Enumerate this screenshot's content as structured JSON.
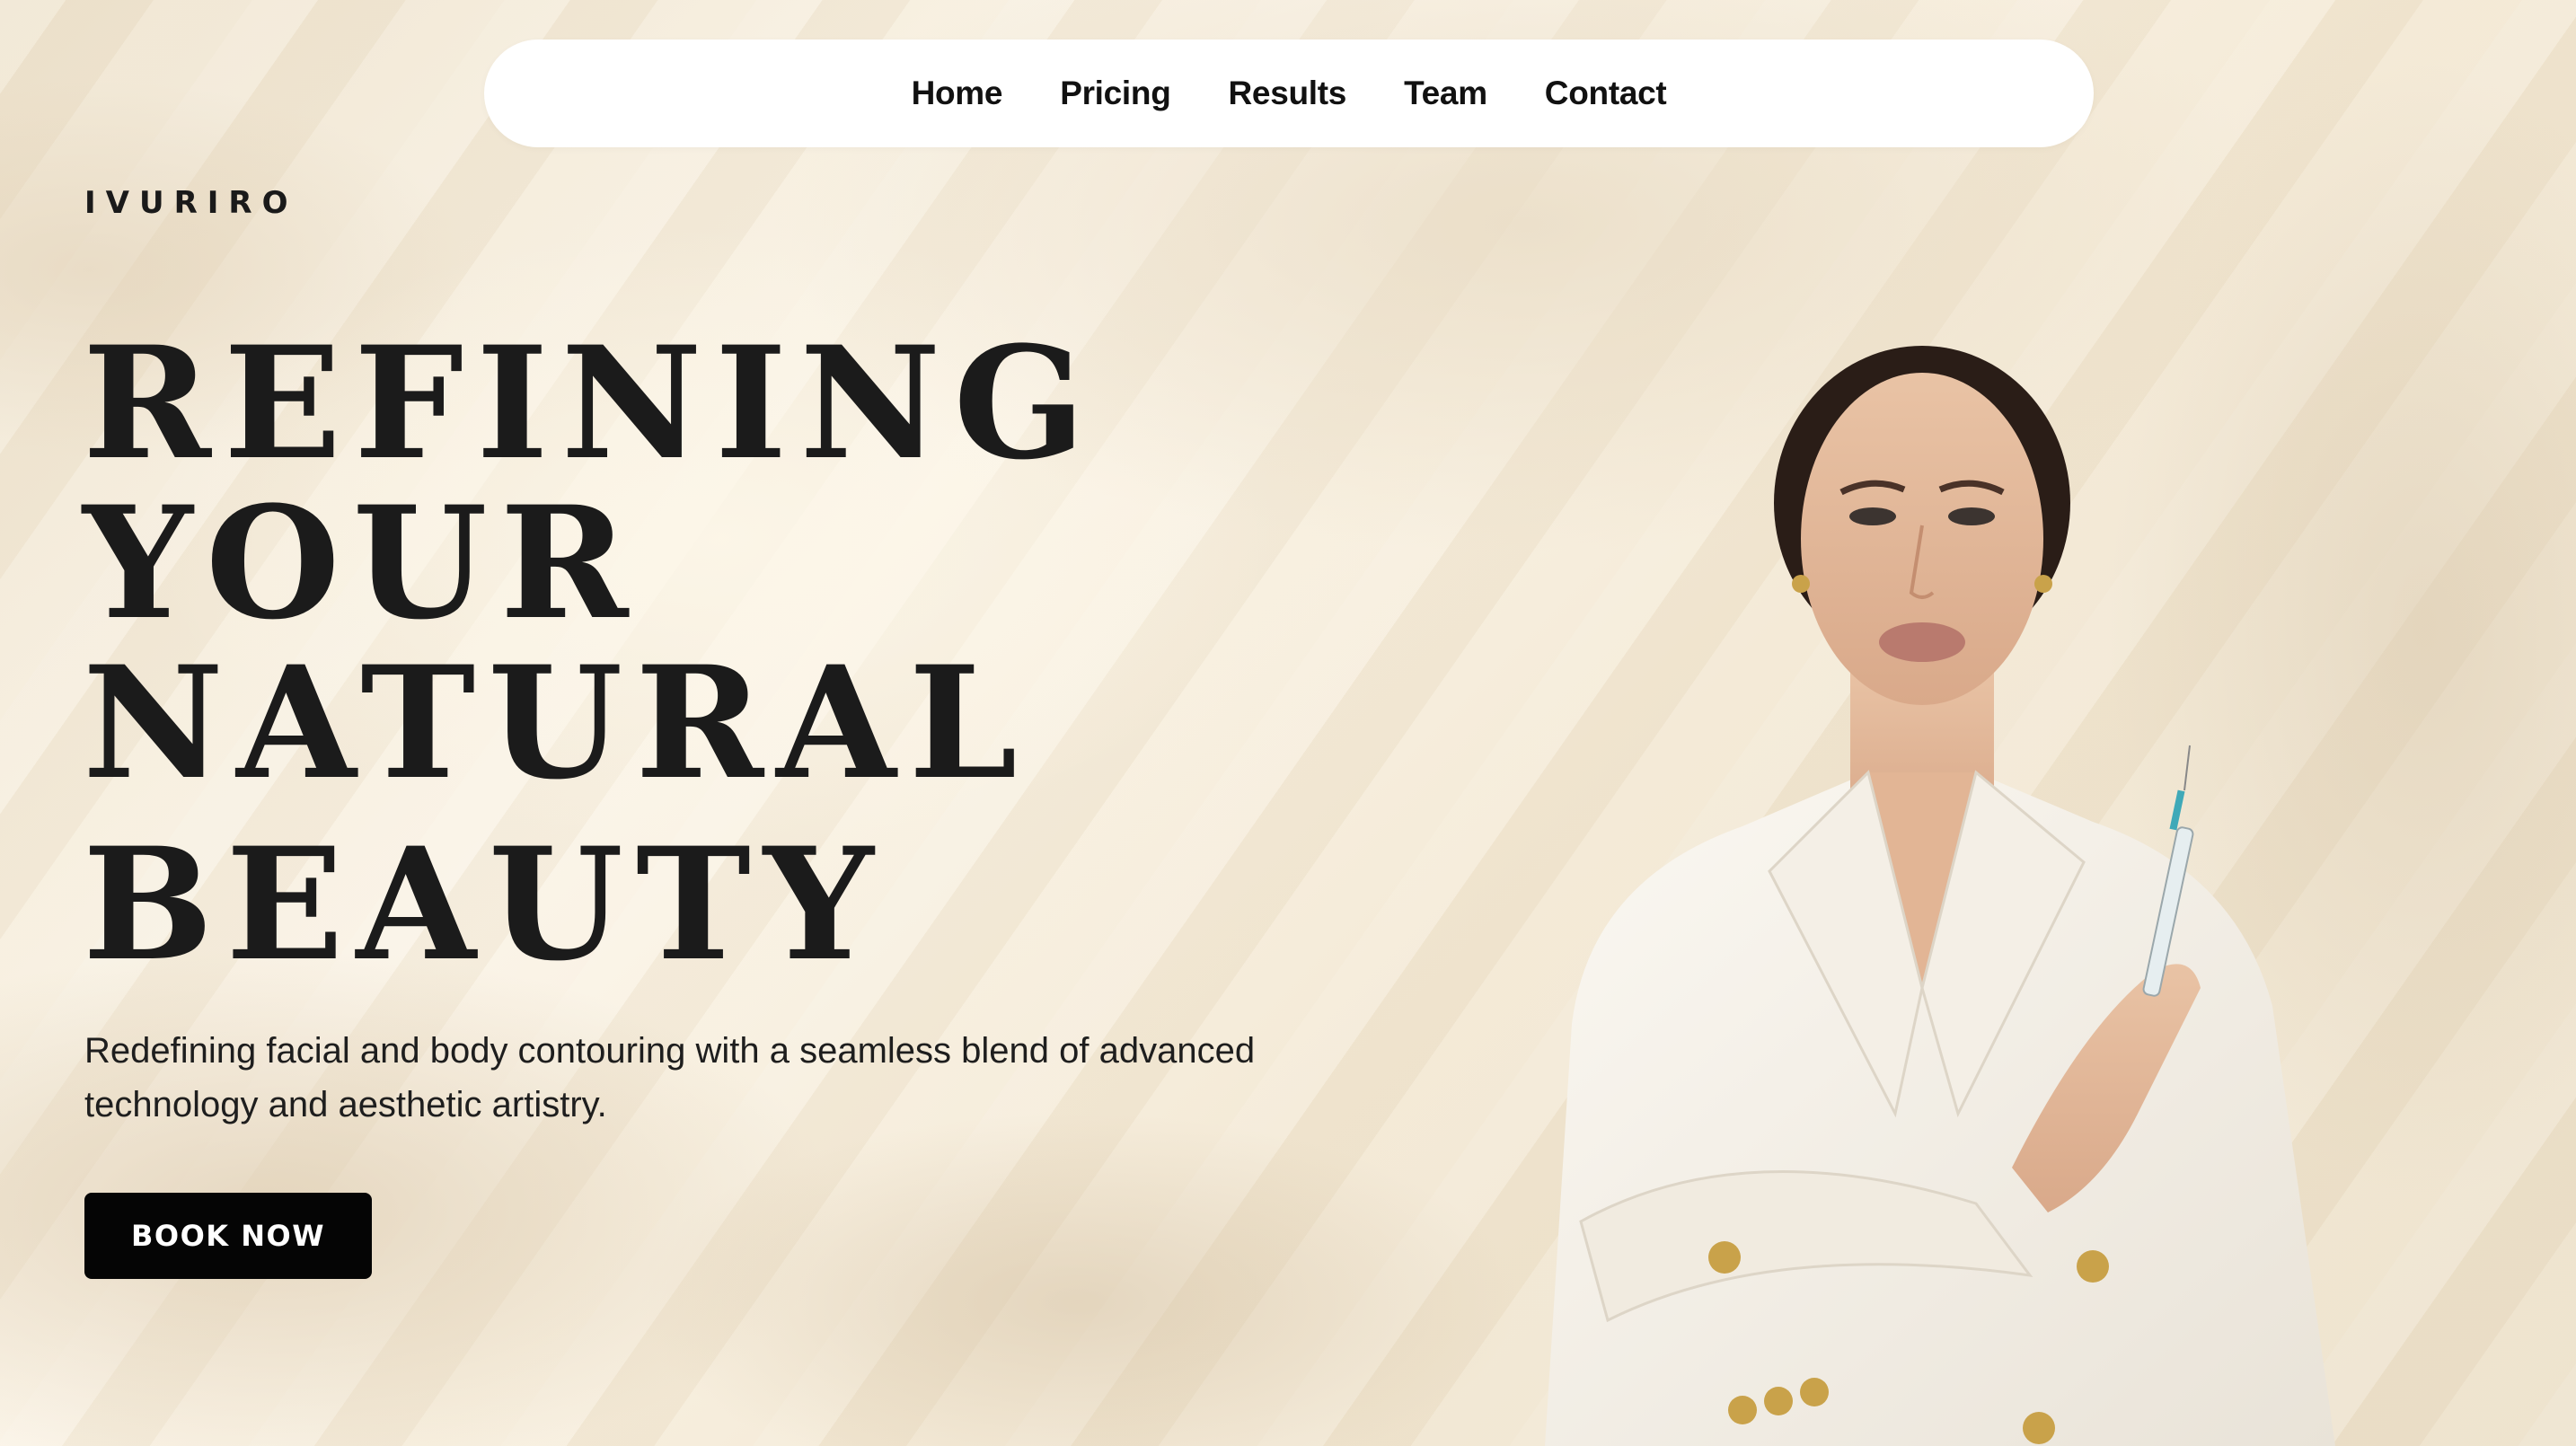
{
  "nav": {
    "items": [
      "Home",
      "Pricing",
      "Results",
      "Team",
      "Contact"
    ]
  },
  "brand": "IVURIRO",
  "hero": {
    "headline_lines": [
      "REFINING",
      "YOUR",
      "NATURAL",
      "BEAUTY"
    ],
    "subtitle": "Redefining facial and body contouring with a seamless blend of advanced technology and aesthetic artistry.",
    "cta_label": "BOOK NOW"
  },
  "colors": {
    "background": "#f6eedf",
    "nav_background": "#ffffff",
    "text": "#1b1b1b",
    "button": "#050505",
    "button_text": "#ffffff"
  },
  "image": {
    "subject": "woman in white double-breasted blazer holding a syringe"
  }
}
